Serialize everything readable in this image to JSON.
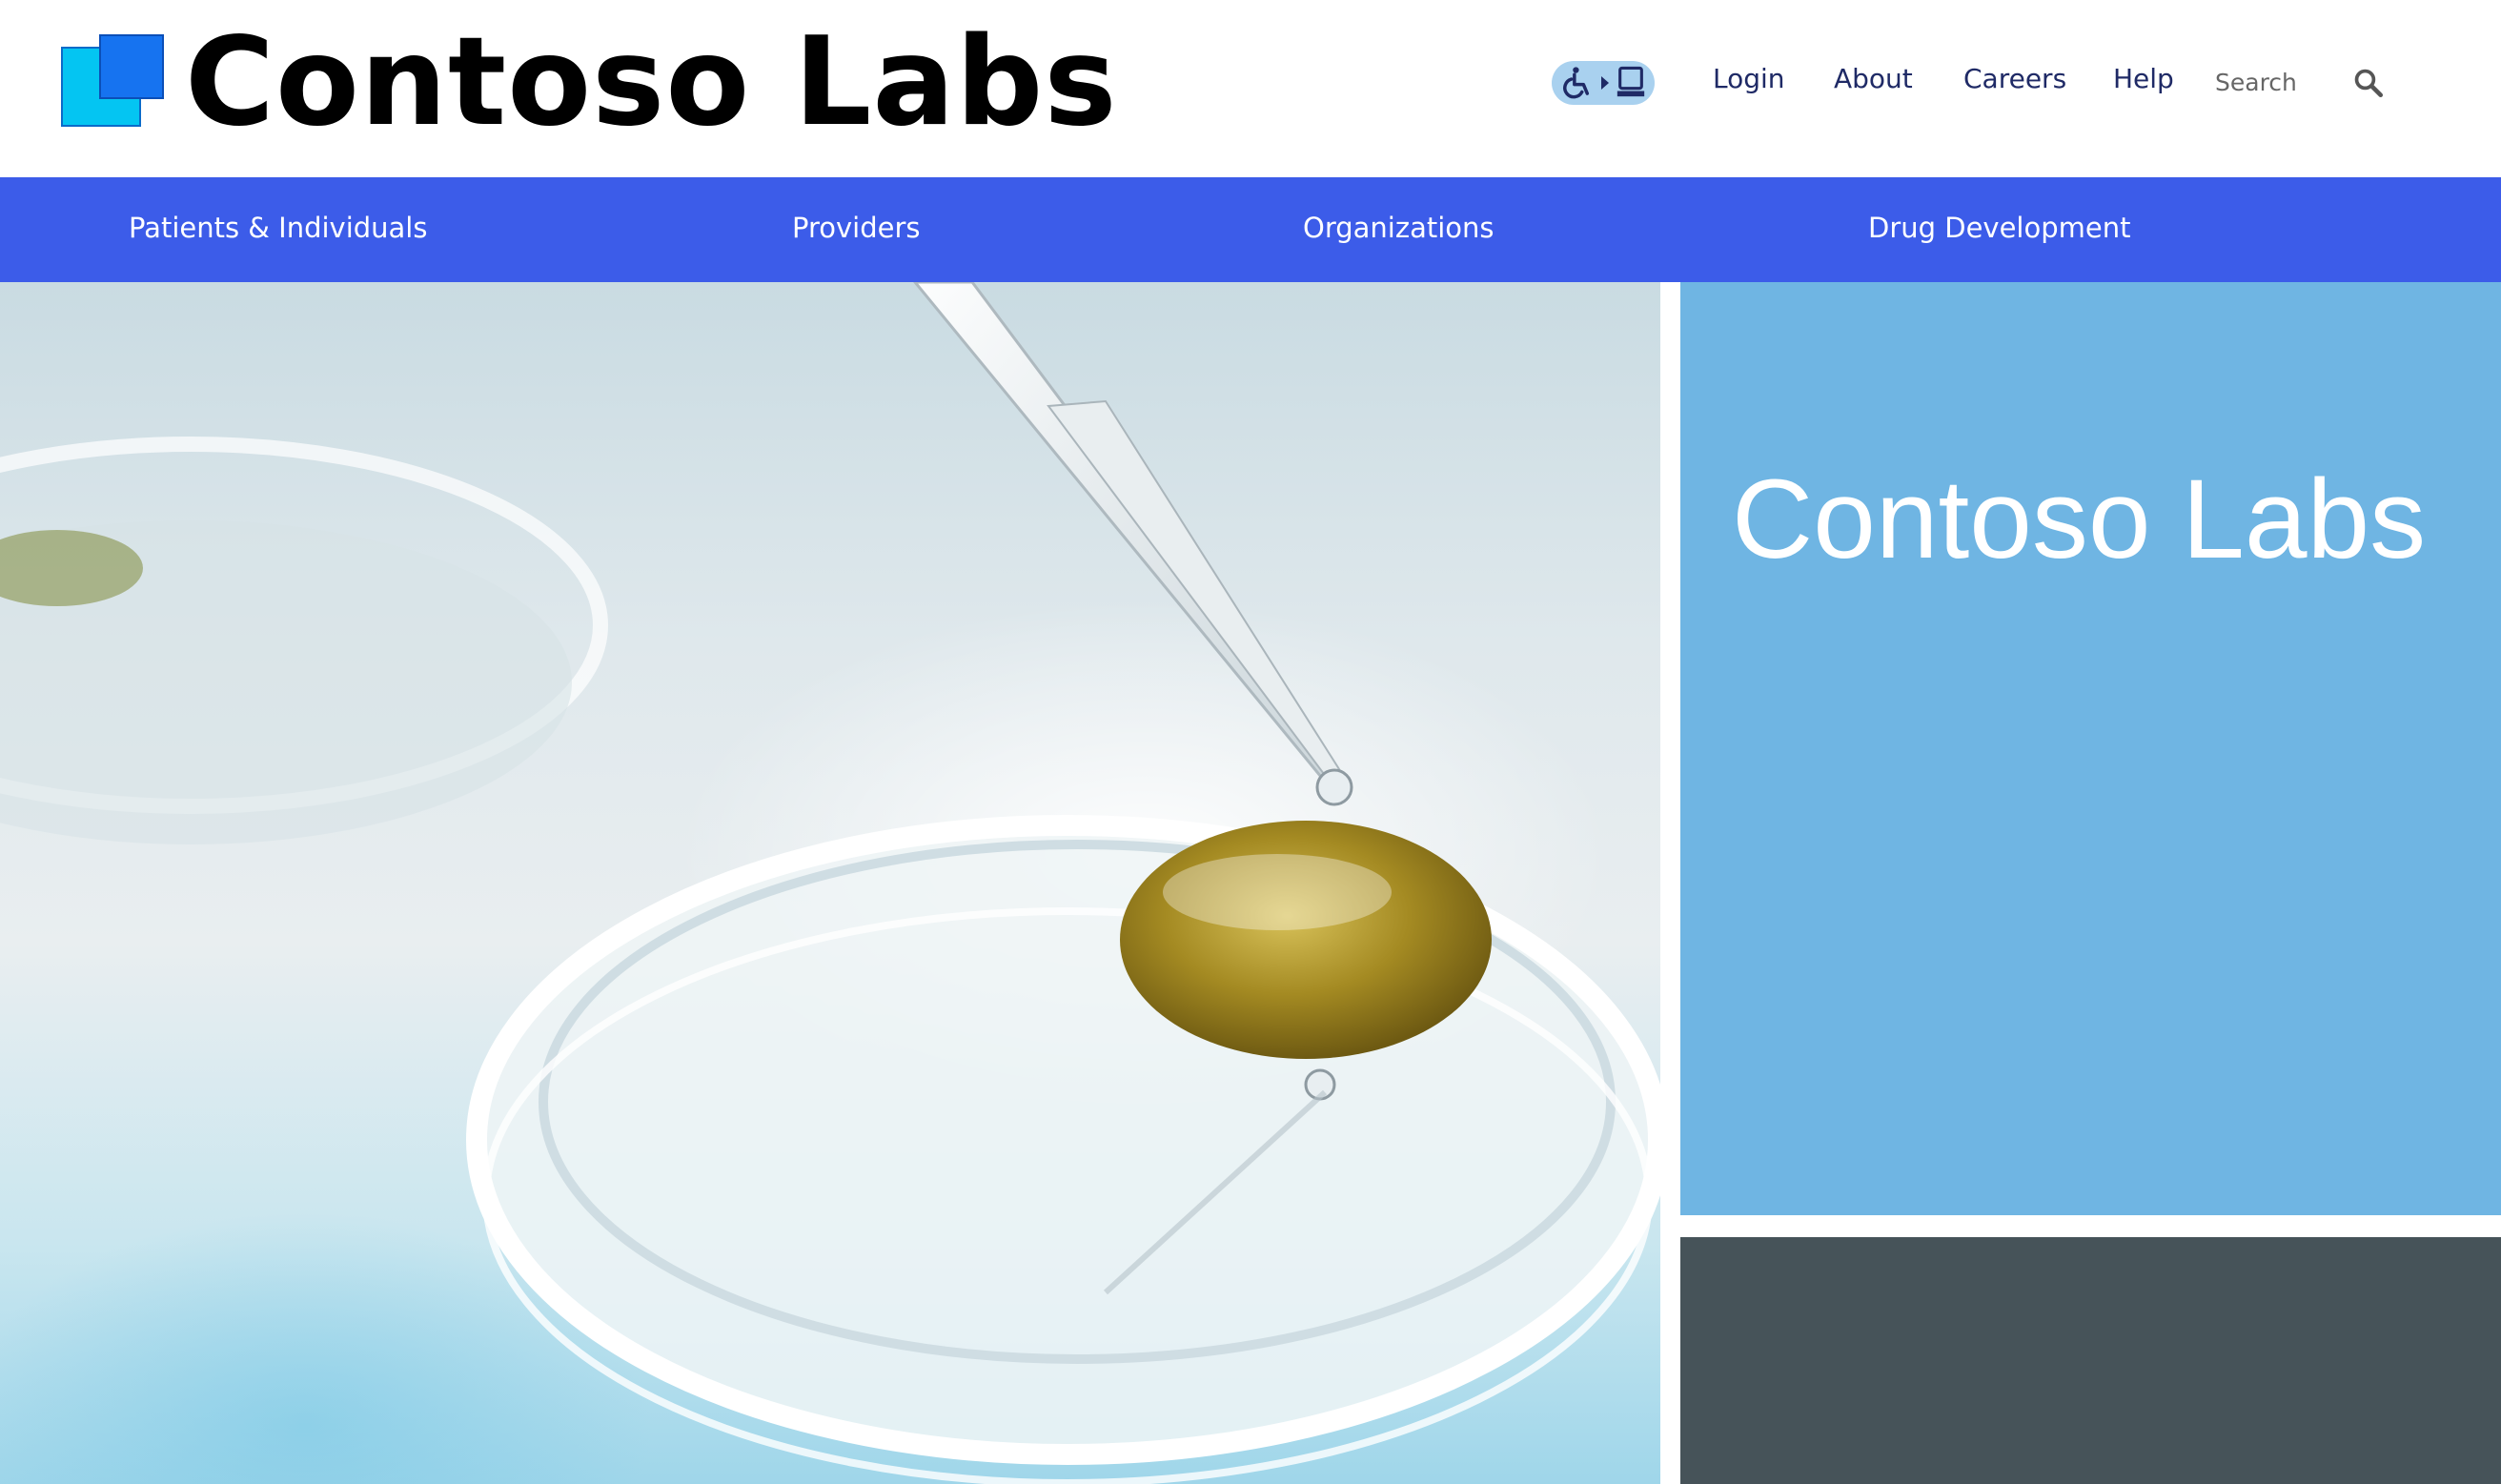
{
  "header": {
    "brand": "Contoso Labs",
    "utility_links": [
      {
        "label": "Login"
      },
      {
        "label": "About"
      },
      {
        "label": "Careers"
      },
      {
        "label": "Help"
      }
    ],
    "search": {
      "placeholder": "Search"
    }
  },
  "nav": {
    "items": [
      {
        "label": "Patients & Individuals"
      },
      {
        "label": "Providers"
      },
      {
        "label": "Organizations"
      },
      {
        "label": "Drug Development"
      }
    ]
  },
  "feature": {
    "title": "Contoso Labs"
  },
  "icons": {
    "accessibility": "accessibility-icon",
    "search": "search-icon"
  },
  "colors": {
    "nav_bg": "#3c5ce9",
    "feature_bg": "#6fb5e3",
    "dark_panel": "#465359",
    "link": "#1f2a66"
  }
}
